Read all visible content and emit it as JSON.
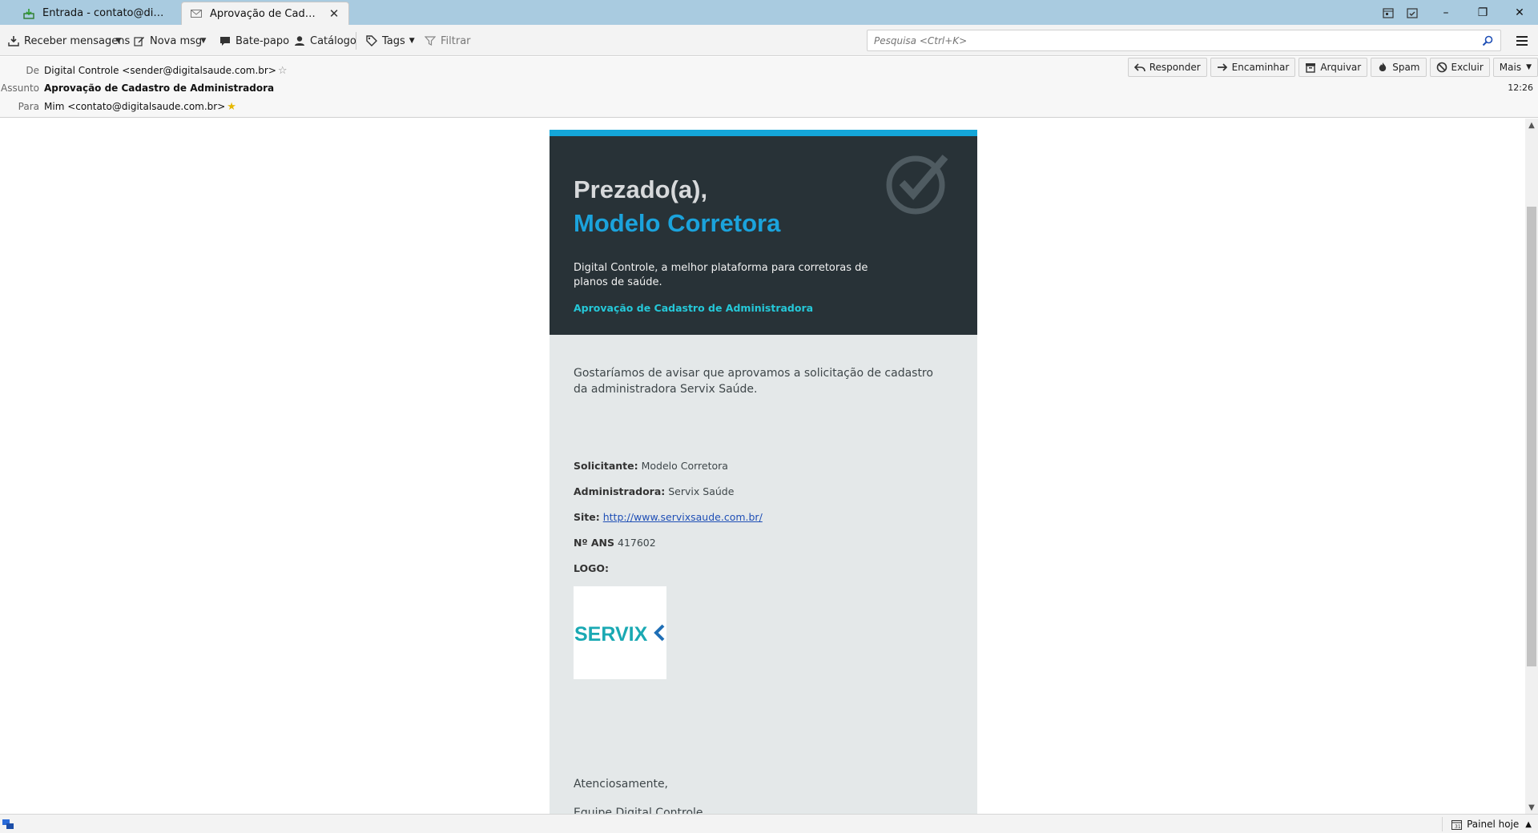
{
  "tabs": [
    {
      "label": "Entrada - contato@digitalsau...",
      "icon": "inbox-icon"
    },
    {
      "label": "Aprovação de Cadastro d...",
      "icon": "envelope-icon",
      "close": "✕"
    }
  ],
  "window": {
    "minimize": "–",
    "maximize": "❐",
    "close": "✕"
  },
  "toolbar": {
    "receive": "Receber mensagens",
    "new_msg": "Nova msg",
    "chat": "Bate-papo",
    "catalog": "Catálogo",
    "tags": "Tags",
    "filter": "Filtrar",
    "search_placeholder": "Pesquisa <Ctrl+K>"
  },
  "header": {
    "from_label": "De",
    "from_value": "Digital Controle <sender@digitalsaude.com.br>",
    "subject_label": "Assunto",
    "subject_value": "Aprovação de Cadastro de Administradora",
    "to_label": "Para",
    "to_value": "Mim <contato@digitalsaude.com.br>",
    "time": "12:26",
    "actions": {
      "reply": "Responder",
      "forward": "Encaminhar",
      "archive": "Arquivar",
      "spam": "Spam",
      "delete": "Excluir",
      "more": "Mais"
    }
  },
  "email": {
    "greeting": "Prezado(a),",
    "recipient_name": "Modelo Corretora",
    "tagline": "Digital Controle, a melhor plataforma para corretoras de planos de saúde.",
    "subject_line": "Aprovação de Cadastro de Administradora",
    "intro": "Gostaríamos de avisar que aprovamos a solicitação de cadastro da administradora Servix Saúde.",
    "details": {
      "requester_label": "Solicitante:",
      "requester_value": "Modelo Corretora",
      "admin_label": "Administradora:",
      "admin_value": "Servix Saúde",
      "site_label": "Site:",
      "site_value": "http://www.servixsaude.com.br/",
      "ans_label": "Nº ANS",
      "ans_value": "417602",
      "logo_label": "LOGO:"
    },
    "logo_text": "SERVIX",
    "signoff": "Atenciosamente,",
    "signature": "Equipe Digital Controle"
  },
  "statusbar": {
    "today_panel": "Painel hoje"
  },
  "colors": {
    "header_dark": "#283237",
    "accent_blue": "#1ba3dc",
    "accent_cyan": "#25c8d8",
    "body_bg": "#e4e8e9",
    "logo_teal": "#1aa9b3"
  }
}
